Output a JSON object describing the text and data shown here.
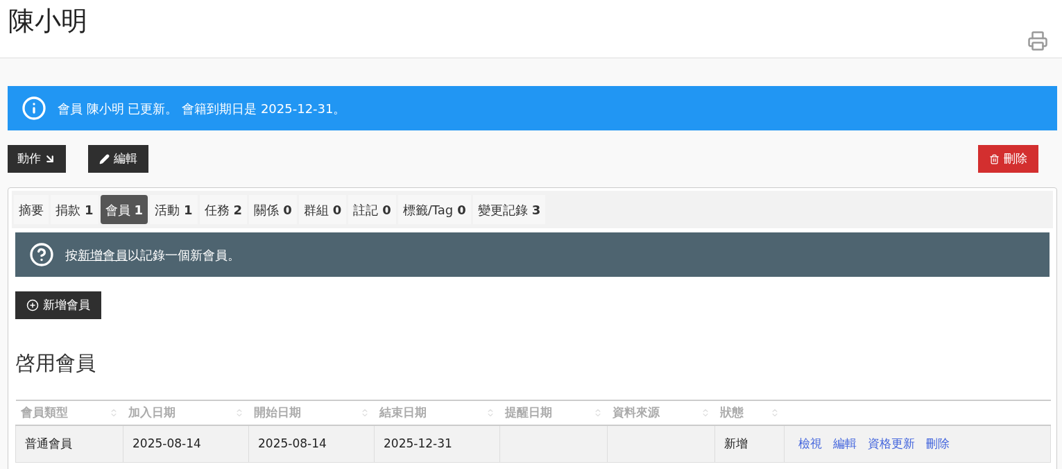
{
  "page": {
    "title": "陳小明"
  },
  "alert": {
    "text": "會員 陳小明 已更新。 會籍到期日是 2025-12-31。"
  },
  "actions": [
    {
      "kind": "menu",
      "label": "動作"
    },
    {
      "kind": "edit",
      "label": "編輯"
    },
    {
      "kind": "delete",
      "label": "刪除"
    }
  ],
  "tabs": [
    {
      "label": "摘要",
      "selected": false
    },
    {
      "label": "捐款",
      "count": "1",
      "selected": false
    },
    {
      "label": "會員",
      "count": "1",
      "selected": true
    },
    {
      "label": "活動",
      "count": "1",
      "selected": false
    },
    {
      "label": "任務",
      "count": "2",
      "selected": false
    },
    {
      "label": "關係",
      "count": "0",
      "selected": false
    },
    {
      "label": "群組",
      "count": "0",
      "selected": false
    },
    {
      "label": "註記",
      "count": "0",
      "selected": false
    },
    {
      "label": "標籤/Tag",
      "count": "0",
      "selected": false
    },
    {
      "label": "變更記錄",
      "count": "3",
      "selected": false
    }
  ],
  "help": {
    "before": "按",
    "link": "新增會員",
    "after": "以記錄一個新會員。"
  },
  "add_button": {
    "label": "新增會員"
  },
  "section_title": "啓用會員",
  "table": {
    "columns": [
      "會員類型",
      "加入日期",
      "開始日期",
      "結束日期",
      "提醒日期",
      "資料來源",
      "狀態"
    ],
    "rows": [
      {
        "cells": [
          "普通會員",
          "2025-08-14",
          "2025-08-14",
          "2025-12-31",
          "",
          "",
          "新增"
        ],
        "links": [
          "檢視",
          "編輯",
          "資格更新",
          "刪除"
        ]
      }
    ]
  }
}
